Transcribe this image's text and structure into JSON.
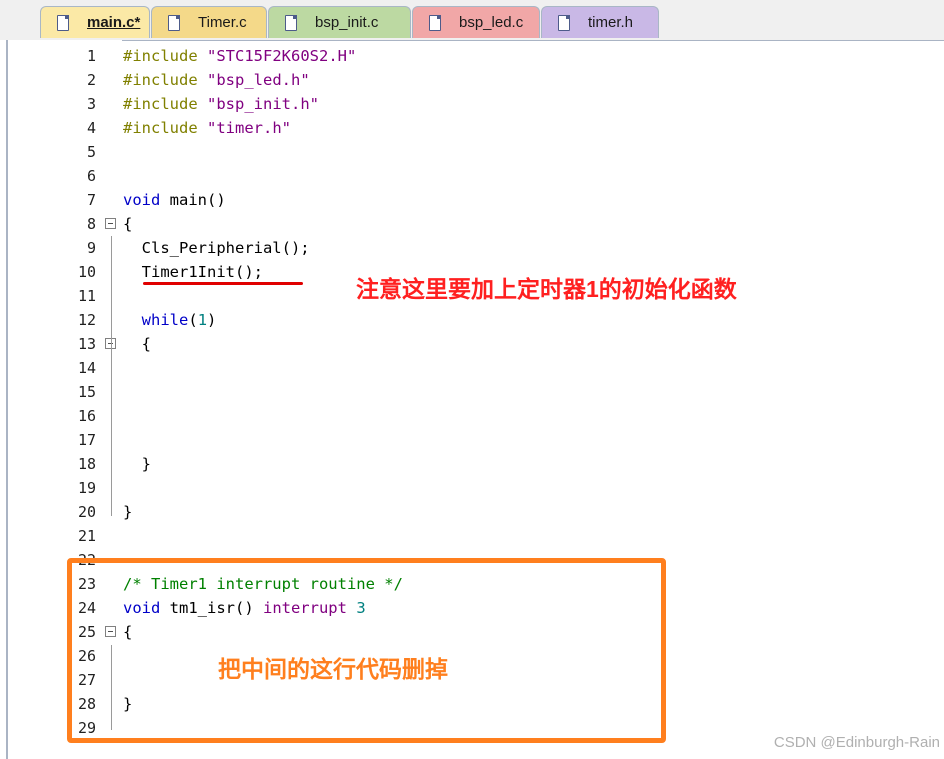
{
  "tabs": [
    {
      "label": "main.c*",
      "active": true,
      "color": "#fbe9a6"
    },
    {
      "label": "Timer.c",
      "active": false,
      "color": "#f4d989"
    },
    {
      "label": "bsp_init.c",
      "active": false,
      "color": "#bcd9a2"
    },
    {
      "label": "bsp_led.c",
      "active": false,
      "color": "#f1a7a7"
    },
    {
      "label": "timer.h",
      "active": false,
      "color": "#c9b8e6"
    }
  ],
  "lines": [
    {
      "n": "1",
      "tokens": [
        [
          "pp",
          "#include "
        ],
        [
          "str",
          "\"STC15F2K60S2.H\""
        ]
      ]
    },
    {
      "n": "2",
      "tokens": [
        [
          "pp",
          "#include "
        ],
        [
          "str",
          "\"bsp_led.h\""
        ]
      ]
    },
    {
      "n": "3",
      "tokens": [
        [
          "pp",
          "#include "
        ],
        [
          "str",
          "\"bsp_init.h\""
        ]
      ]
    },
    {
      "n": "4",
      "tokens": [
        [
          "pp",
          "#include "
        ],
        [
          "str",
          "\"timer.h\""
        ]
      ]
    },
    {
      "n": "5",
      "tokens": []
    },
    {
      "n": "6",
      "tokens": []
    },
    {
      "n": "7",
      "tokens": [
        [
          "kw",
          "void"
        ],
        [
          "",
          " main()"
        ]
      ]
    },
    {
      "n": "8",
      "fold": true,
      "tokens": [
        [
          "",
          "{"
        ]
      ]
    },
    {
      "n": "9",
      "tokens": [
        [
          "",
          "  Cls_Peripherial();"
        ]
      ]
    },
    {
      "n": "10",
      "tokens": [
        [
          "",
          "  Timer1Init();"
        ]
      ]
    },
    {
      "n": "11",
      "tokens": []
    },
    {
      "n": "12",
      "tokens": [
        [
          "",
          "  "
        ],
        [
          "kw",
          "while"
        ],
        [
          "",
          "("
        ],
        [
          "num",
          "1"
        ],
        [
          "",
          ")"
        ]
      ]
    },
    {
      "n": "13",
      "fold": true,
      "tokens": [
        [
          "",
          "  {"
        ]
      ]
    },
    {
      "n": "14",
      "tokens": []
    },
    {
      "n": "15",
      "tokens": []
    },
    {
      "n": "16",
      "tokens": []
    },
    {
      "n": "17",
      "tokens": []
    },
    {
      "n": "18",
      "tokens": [
        [
          "",
          "  }"
        ]
      ]
    },
    {
      "n": "19",
      "tokens": []
    },
    {
      "n": "20",
      "tokens": [
        [
          "",
          "}"
        ]
      ]
    },
    {
      "n": "21",
      "tokens": []
    },
    {
      "n": "22",
      "tokens": []
    },
    {
      "n": "23",
      "tokens": [
        [
          "cmt",
          "/* Timer1 interrupt routine */"
        ]
      ]
    },
    {
      "n": "24",
      "tokens": [
        [
          "kw",
          "void"
        ],
        [
          "",
          " tm1_isr() "
        ],
        [
          "str",
          "interrupt"
        ],
        [
          "",
          " "
        ],
        [
          "num",
          "3"
        ]
      ]
    },
    {
      "n": "25",
      "fold": true,
      "tokens": [
        [
          "",
          "{"
        ]
      ]
    },
    {
      "n": "26",
      "tokens": []
    },
    {
      "n": "27",
      "tokens": []
    },
    {
      "n": "28",
      "tokens": [
        [
          "",
          "}"
        ]
      ]
    },
    {
      "n": "29",
      "tokens": []
    }
  ],
  "annotations": {
    "note_timer_init": "注意这里要加上定时器1的初始化函数",
    "note_delete": "把中间的这行代码删掉"
  },
  "watermark": "CSDN @Edinburgh-Rain",
  "colors": {
    "annotation_red": "#ff2020",
    "annotation_orange": "#ff7f1e"
  }
}
